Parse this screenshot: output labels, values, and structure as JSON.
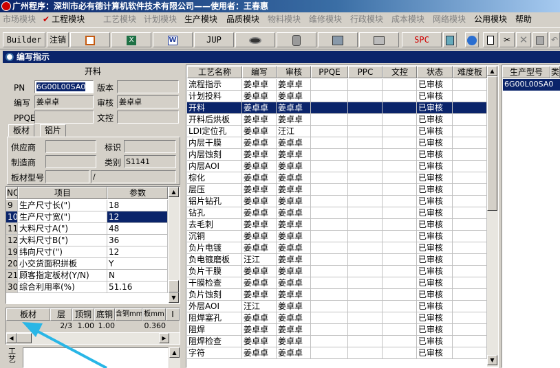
{
  "window": {
    "title": "广州程序：深圳市必有德计算机软件技术有限公司——使用者：王春惠"
  },
  "menu": [
    {
      "label": "市场模块",
      "enabled": false
    },
    {
      "label": "工程模块",
      "enabled": true,
      "checked": true
    },
    {
      "label": "工艺模块",
      "enabled": false
    },
    {
      "label": "计划模块",
      "enabled": false
    },
    {
      "label": "生产模块",
      "enabled": true
    },
    {
      "label": "品质模块",
      "enabled": true
    },
    {
      "label": "物料模块",
      "enabled": false
    },
    {
      "label": "维修模块",
      "enabled": false
    },
    {
      "label": "行政模块",
      "enabled": false
    },
    {
      "label": "成本模块",
      "enabled": false
    },
    {
      "label": "网络模块",
      "enabled": false
    },
    {
      "label": "公用模块",
      "enabled": true
    },
    {
      "label": "帮助",
      "enabled": true
    }
  ],
  "toolbar": {
    "builder": "Builder",
    "logout": "注销",
    "jup": "JUP",
    "spc": "SPC"
  },
  "panel": {
    "title": "编写指示"
  },
  "form": {
    "section_title": "开料",
    "pn_label": "PN",
    "pn_value": "6G00L00SA0",
    "version_label": "版本",
    "version_value": "",
    "writer_label": "编写",
    "writer_value": "姜卓卓",
    "reviewer_label": "审核",
    "reviewer_value": "姜卓卓",
    "ppqe_label": "PPQE",
    "ppqe_value": "",
    "control_label": "文控",
    "control_value": "",
    "tabs": [
      "板材",
      "铝片"
    ],
    "supplier_label": "供应商",
    "supplier_value": "",
    "mark_label": "标识",
    "mark_value": "",
    "maker_label": "制造商",
    "maker_value": "",
    "category_label": "类别",
    "category_value": "S1141",
    "model_label": "板材型号",
    "model_value": "",
    "model_value2": "/"
  },
  "param_table": {
    "headers": [
      "NO",
      "项目",
      "参数"
    ],
    "rows": [
      [
        "9",
        "生产尺寸长(\")",
        "18"
      ],
      [
        "10",
        "生产尺寸宽(\")",
        "12"
      ],
      [
        "11",
        "大料尺寸A(\")",
        "48"
      ],
      [
        "12",
        "大料尺寸B(\")",
        "36"
      ],
      [
        "19",
        "纬向尺寸(\")",
        "12"
      ],
      [
        "20",
        "小交货面积拼板",
        "Y"
      ],
      [
        "21",
        "顾客指定板材(Y/N)",
        "N"
      ],
      [
        "30",
        "综合利用率(%)",
        "51.16"
      ]
    ],
    "selected_index": 1
  },
  "material_table": {
    "headers": [
      "板材",
      "层",
      "顶铜",
      "底铜",
      "含铜mm",
      "板mm",
      "I"
    ],
    "rows": [
      [
        "",
        "2/3",
        "1.00",
        "1.00",
        "",
        "0.360",
        ""
      ]
    ]
  },
  "bottom_label": "工艺",
  "process_table": {
    "headers": [
      "工艺名称",
      "编写",
      "审核",
      "PPQE",
      "PPC",
      "文控",
      "状态",
      "难度板"
    ],
    "rows": [
      [
        "流程指示",
        "姜卓卓",
        "姜卓卓",
        "",
        "",
        "",
        "已审核",
        ""
      ],
      [
        "计划投料",
        "姜卓卓",
        "姜卓卓",
        "",
        "",
        "",
        "已审核",
        ""
      ],
      [
        "开料",
        "姜卓卓",
        "姜卓卓",
        "",
        "",
        "",
        "已审核",
        ""
      ],
      [
        "开料后烘板",
        "姜卓卓",
        "姜卓卓",
        "",
        "",
        "",
        "已审核",
        ""
      ],
      [
        "LDI定位孔",
        "姜卓卓",
        "汪江",
        "",
        "",
        "",
        "已审核",
        ""
      ],
      [
        "内层干膜",
        "姜卓卓",
        "姜卓卓",
        "",
        "",
        "",
        "已审核",
        ""
      ],
      [
        "内层蚀刻",
        "姜卓卓",
        "姜卓卓",
        "",
        "",
        "",
        "已审核",
        ""
      ],
      [
        "内层AOI",
        "姜卓卓",
        "姜卓卓",
        "",
        "",
        "",
        "已审核",
        ""
      ],
      [
        "棕化",
        "姜卓卓",
        "姜卓卓",
        "",
        "",
        "",
        "已审核",
        ""
      ],
      [
        "层压",
        "姜卓卓",
        "姜卓卓",
        "",
        "",
        "",
        "已审核",
        ""
      ],
      [
        "铝片钻孔",
        "姜卓卓",
        "姜卓卓",
        "",
        "",
        "",
        "已审核",
        ""
      ],
      [
        "钻孔",
        "姜卓卓",
        "姜卓卓",
        "",
        "",
        "",
        "已审核",
        ""
      ],
      [
        "去毛刺",
        "姜卓卓",
        "姜卓卓",
        "",
        "",
        "",
        "已审核",
        ""
      ],
      [
        "沉铜",
        "姜卓卓",
        "姜卓卓",
        "",
        "",
        "",
        "已审核",
        ""
      ],
      [
        "负片电镀",
        "姜卓卓",
        "姜卓卓",
        "",
        "",
        "",
        "已审核",
        ""
      ],
      [
        "负电镀磨板",
        "汪江",
        "姜卓卓",
        "",
        "",
        "",
        "已审核",
        ""
      ],
      [
        "负片干膜",
        "姜卓卓",
        "姜卓卓",
        "",
        "",
        "",
        "已审核",
        ""
      ],
      [
        "干膜检查",
        "姜卓卓",
        "姜卓卓",
        "",
        "",
        "",
        "已审核",
        ""
      ],
      [
        "负片蚀刻",
        "姜卓卓",
        "姜卓卓",
        "",
        "",
        "",
        "已审核",
        ""
      ],
      [
        "外层AOI",
        "汪江",
        "姜卓卓",
        "",
        "",
        "",
        "已审核",
        ""
      ],
      [
        "阻焊塞孔",
        "姜卓卓",
        "姜卓卓",
        "",
        "",
        "",
        "已审核",
        ""
      ],
      [
        "阻焊",
        "姜卓卓",
        "姜卓卓",
        "",
        "",
        "",
        "已审核",
        ""
      ],
      [
        "阻焊检查",
        "姜卓卓",
        "姜卓卓",
        "",
        "",
        "",
        "已审核",
        ""
      ],
      [
        "字符",
        "姜卓卓",
        "姜卓卓",
        "",
        "",
        "",
        "已审核",
        ""
      ]
    ],
    "selected_index": 2
  },
  "model_table": {
    "headers": [
      "生产型号",
      "类"
    ],
    "rows": [
      [
        "6G00L00SA0"
      ]
    ]
  },
  "colors": {
    "selection": "#0a246a",
    "title_bar": "#0a246a",
    "arrow": "#29b6e6"
  }
}
